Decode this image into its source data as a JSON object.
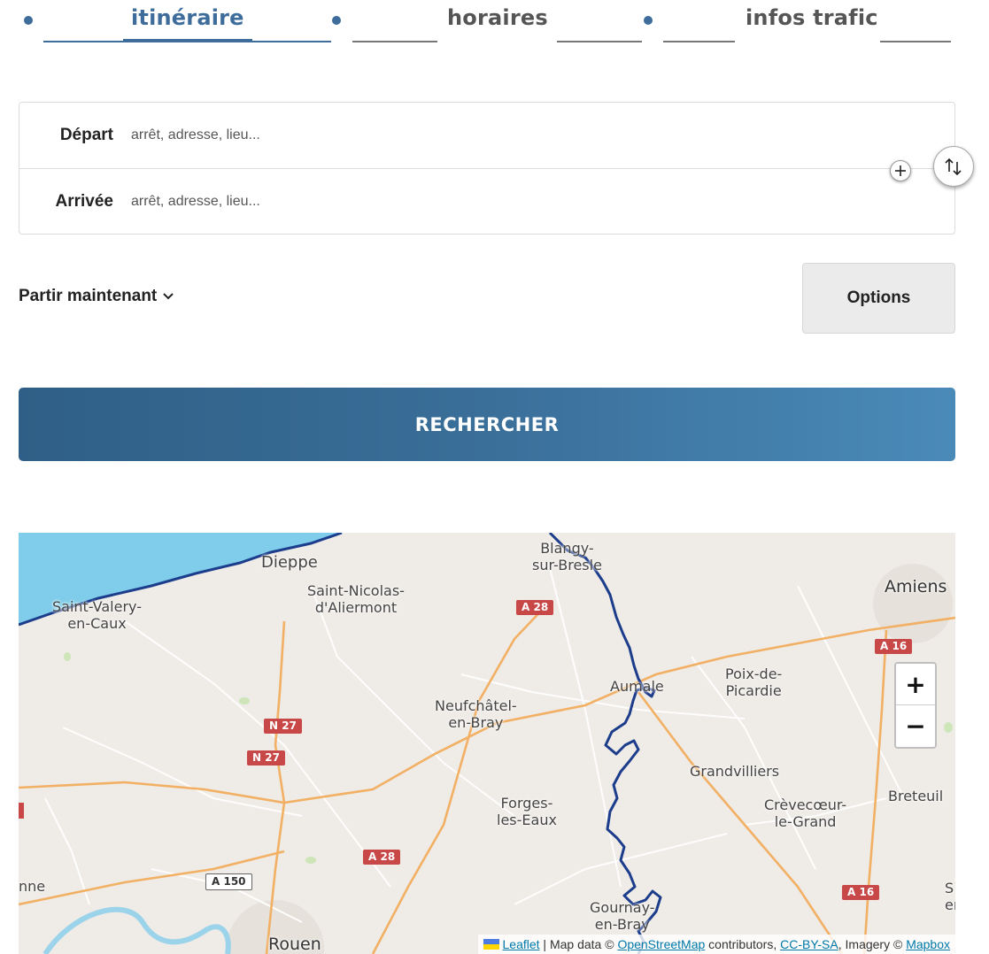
{
  "tabs": [
    {
      "label": "itinéraire",
      "active": true
    },
    {
      "label": "horaires",
      "active": false
    },
    {
      "label": "infos trafic",
      "active": false
    }
  ],
  "form": {
    "departure": {
      "label": "Départ",
      "placeholder": "arrêt, adresse, lieu...",
      "value": ""
    },
    "arrival": {
      "label": "Arrivée",
      "placeholder": "arrêt, adresse, lieu...",
      "value": ""
    },
    "add_icon": "plus-icon",
    "swap_icon": "swap-arrows-icon"
  },
  "time_selector": {
    "label": "Partir maintenant",
    "icon": "chevron-down-icon"
  },
  "options_label": "Options",
  "search_label": "RECHERCHER",
  "colors": {
    "accent": "#3e6c9b",
    "button_gradient": [
      "#2f5f86",
      "#4a8ab9"
    ],
    "route": "#1c3c8c",
    "road_shield": "#c84848",
    "water": "#7fcdea"
  },
  "map": {
    "towns": [
      "Dieppe",
      "Saint-Valery-\nen-Caux",
      "Saint-Nicolas-\nd'Aliermont",
      "Blangy-\nsur-Bresle",
      "Amiens",
      "Aumale",
      "Poix-de-\nPicardie",
      "Neufchâtel-\nen-Bray",
      "Grandvilliers",
      "Breteuil",
      "Forges-\nles-Eaux",
      "Crèvecœur-\nle-Grand",
      "Gournay-\nen-Bray",
      "Rouen",
      "nne",
      "S\ner"
    ],
    "road_shields": [
      "A 28",
      "A 16",
      "N 27",
      "N 27",
      "A 28",
      "A 150",
      "A 16"
    ],
    "zoom_in": "+",
    "zoom_out": "−",
    "attribution": {
      "leaflet": "Leaflet",
      "sep": " | Map data © ",
      "osm": "OpenStreetMap",
      "contributors": " contributors, ",
      "license": "CC-BY-SA",
      "imagery": ", Imagery © ",
      "mapbox": "Mapbox"
    }
  }
}
